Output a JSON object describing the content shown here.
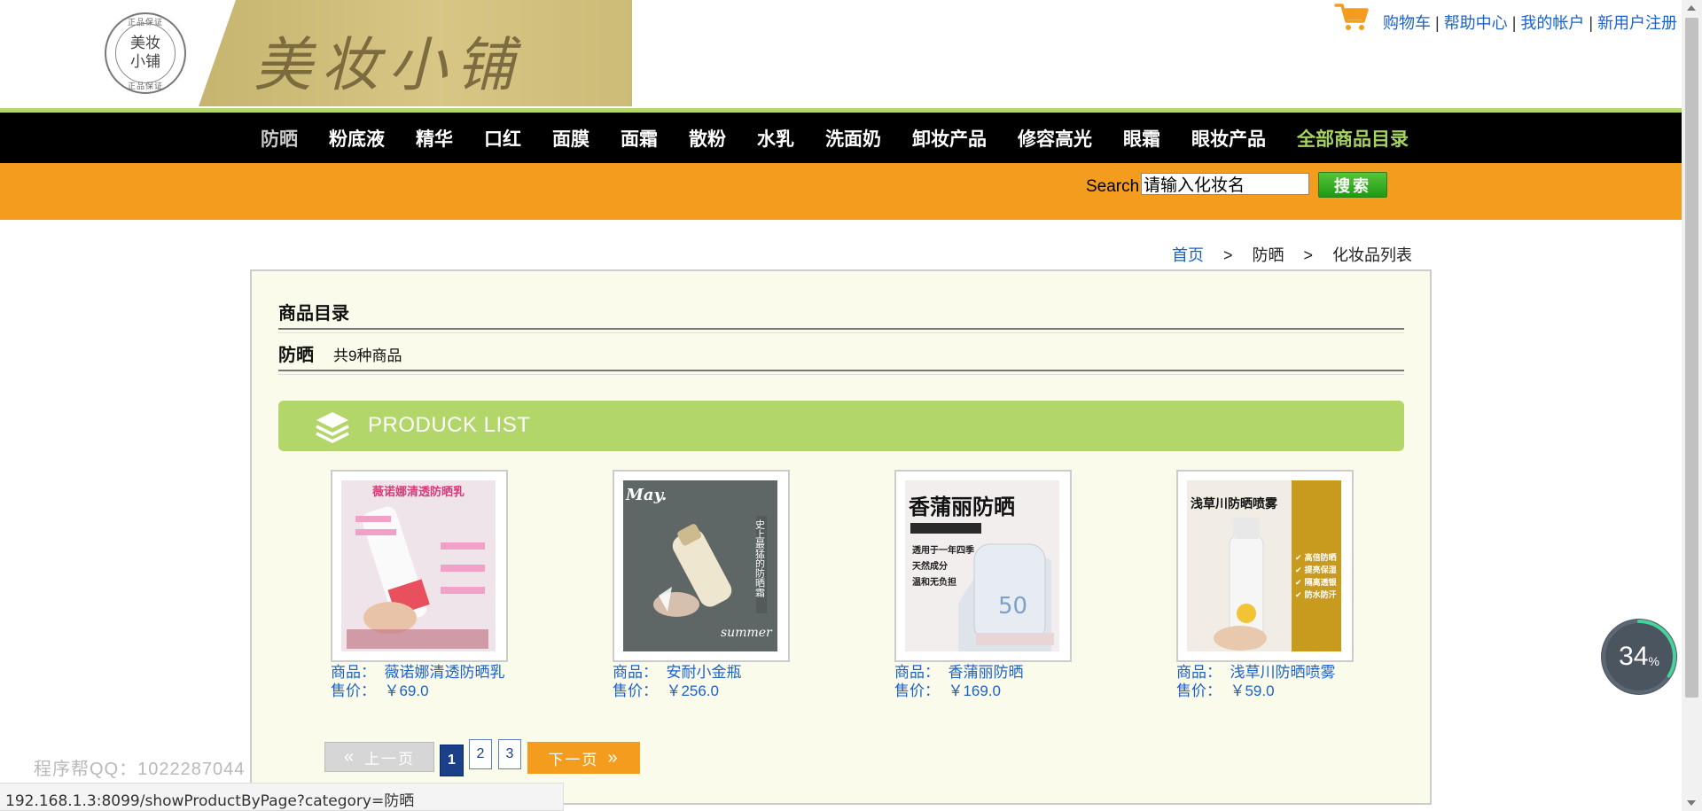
{
  "brand": {
    "seal_text_line1": "美妆",
    "seal_text_line2": "小铺",
    "seal_ring_top": "正品保证",
    "seal_ring_bottom": "正品保证",
    "banner_text": "美妆小铺"
  },
  "top_links": {
    "cart": "购物车",
    "help": "帮助中心",
    "account": "我的帐户",
    "register": "新用户注册",
    "separator": "|"
  },
  "nav": {
    "items": [
      "防晒",
      "粉底液",
      "精华",
      "口红",
      "面膜",
      "面霜",
      "散粉",
      "水乳",
      "洗面奶",
      "卸妆产品",
      "修容高光",
      "眼霜",
      "眼妆产品"
    ],
    "active": "防晒",
    "all_products": "全部商品目录"
  },
  "search": {
    "label": "Search",
    "value": "请输入化妆名",
    "button": "搜索"
  },
  "breadcrumb": {
    "home": "首页",
    "category": "防晒",
    "page": "化妆品列表",
    "arrow": ">"
  },
  "catalog": {
    "title": "商品目录",
    "category_name": "防晒",
    "count_text": "共9种商品",
    "list_banner": "PRODUCK LIST"
  },
  "products": [
    {
      "name_label": "商品：",
      "name": "薇诺娜清透防晒乳",
      "price_label": "售价：",
      "price": "￥69.0",
      "img_caption": "薇诺娜清透防晒乳"
    },
    {
      "name_label": "商品：",
      "name": "安耐小金瓶",
      "price_label": "售价：",
      "price": "￥256.0",
      "img_caption": "May."
    },
    {
      "name_label": "商品：",
      "name": "香蒲丽防晒",
      "price_label": "售价：",
      "price": "￥169.0",
      "img_caption": "香蒲丽防晒"
    },
    {
      "name_label": "商品：",
      "name": "浅草川防晒喷雾",
      "price_label": "售价：",
      "price": "￥59.0",
      "img_caption": "浅草川防晒喷雾"
    }
  ],
  "pager": {
    "prev": "上一页",
    "pages": [
      "1",
      "2",
      "3"
    ],
    "current": "1",
    "next": "下一页"
  },
  "watermark": "程序帮QQ：1022287044",
  "status_url": "192.168.1.3:8099/showProductByPage?category=防晒",
  "speed_widget": {
    "value": "34",
    "unit": "%"
  },
  "colors": {
    "nav_accent": "#b2d66a",
    "search_bar": "#f49c1e",
    "link": "#1b62c9",
    "panel_bg": "#fbfbeb"
  }
}
